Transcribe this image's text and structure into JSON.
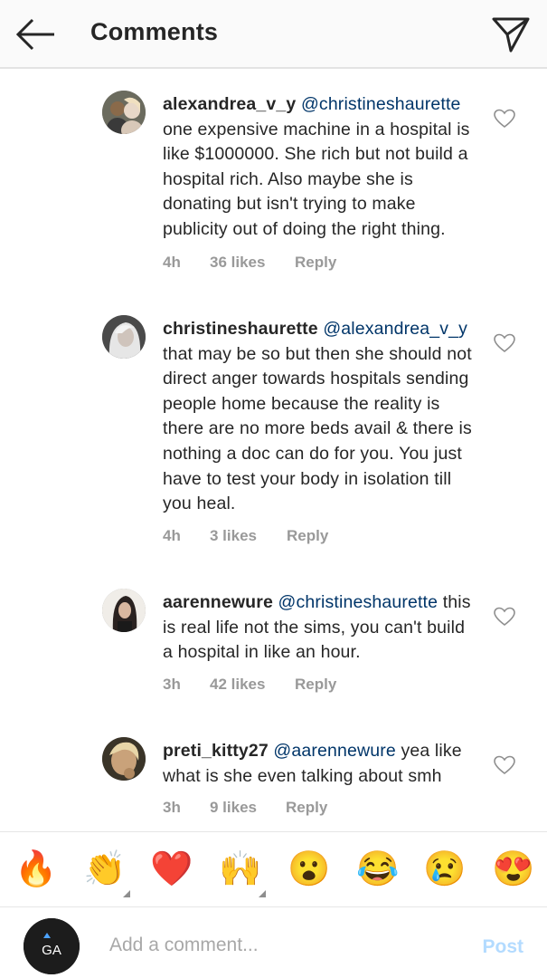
{
  "header": {
    "title": "Comments"
  },
  "comments": [
    {
      "username": "alexandrea_v_y",
      "mention": "@christineshaurette",
      "text": "one expensive machine in a hospital is like $1000000. She rich but not build a hospital rich. Also maybe she is donating but isn't trying to make publicity out of doing the right thing.",
      "time": "4h",
      "likes": "36 likes",
      "reply": "Reply"
    },
    {
      "username": "christineshaurette",
      "mention": "@alexandrea_v_y",
      "text": "that may be so but then she should not direct anger towards hospitals sending people home because the reality is there are no more beds avail & there is nothing a doc can do for you. You just have to test your body in isolation till you heal.",
      "time": "4h",
      "likes": "3 likes",
      "reply": "Reply"
    },
    {
      "username": "aarennewure",
      "mention": "@christineshaurette",
      "text": "this is real life not the sims, you can't build a hospital in like an hour.",
      "time": "3h",
      "likes": "42 likes",
      "reply": "Reply"
    },
    {
      "username": "preti_kitty27",
      "mention": "@aarennewure",
      "text": "yea like what is she even talking about smh",
      "time": "3h",
      "likes": "9 likes",
      "reply": "Reply"
    }
  ],
  "emoji_bar": {
    "emojis": [
      "🔥",
      "👏",
      "❤️",
      "🙌",
      "😮",
      "😂",
      "😢",
      "😍"
    ]
  },
  "compose": {
    "placeholder": "Add a comment...",
    "post_label": "Post",
    "avatar_logo": "GA"
  }
}
